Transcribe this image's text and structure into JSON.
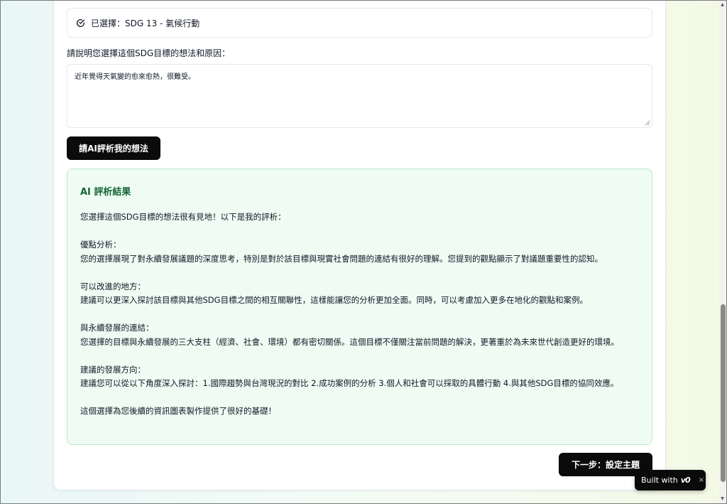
{
  "selection": {
    "text": "已選擇：SDG 13 - 氣候行動",
    "icon": "check-circle-icon"
  },
  "reason": {
    "label": "請說明您選擇這個SDG目標的想法和原因：",
    "value": "近年覺得天氣變的愈來愈熱，很難受。"
  },
  "buttons": {
    "evaluate": "請AI評析我的想法",
    "next": "下一步：設定主題"
  },
  "result": {
    "title": "AI 評析結果",
    "body": "您選擇這個SDG目標的想法很有見地！以下是我的評析：\n\n優點分析：\n您的選擇展現了對永續發展議題的深度思考，特別是對於該目標與現實社會問題的連結有很好的理解。您提到的觀點顯示了對議題重要性的認知。\n\n可以改進的地方：\n建議可以更深入探討該目標與其他SDG目標之間的相互關聯性，這樣能讓您的分析更加全面。同時，可以考慮加入更多在地化的觀點和案例。\n\n與永續發展的連結：\n您選擇的目標與永續發展的三大支柱（經濟、社會、環境）都有密切關係。這個目標不僅關注當前問題的解決，更著重於為未來世代創造更好的環境。\n\n建議的發展方向：\n建議您可以從以下角度深入探討：1.國際趨勢與台灣現況的對比 2.成功案例的分析 3.個人和社會可以採取的具體行動 4.與其他SDG目標的協同效應。\n\n這個選擇為您後續的資訊圖表製作提供了很好的基礎！"
  },
  "badge": {
    "text": "Built with",
    "logo": "v0",
    "close": "×"
  }
}
